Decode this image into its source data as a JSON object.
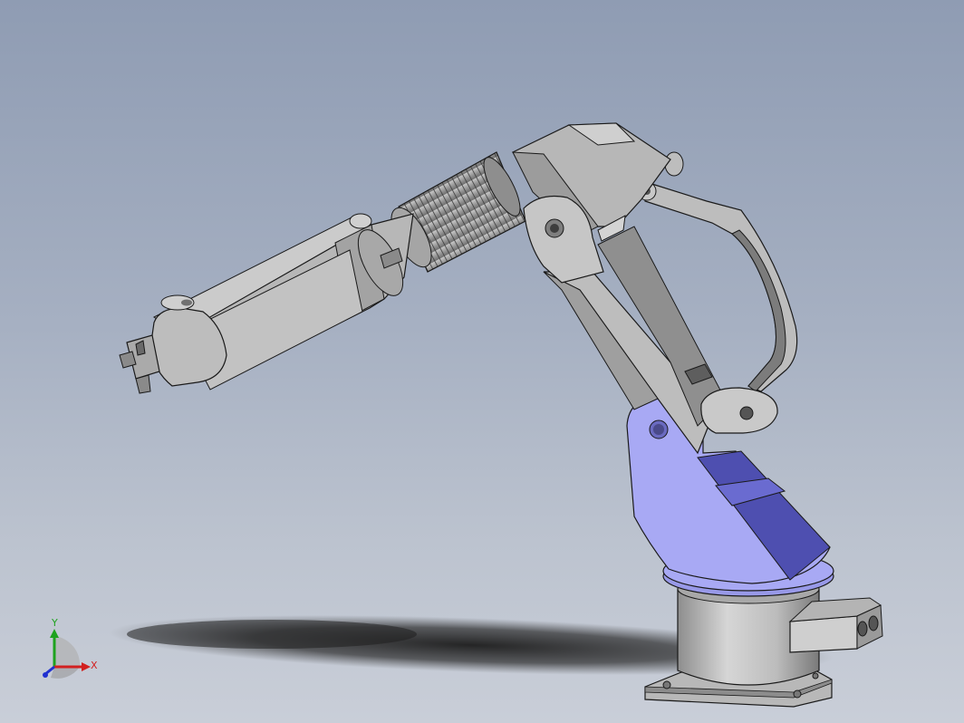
{
  "viewport": {
    "background_top": "#8f9cb3",
    "background_bottom": "#c9ced8",
    "model_color": "#c4c4c4",
    "highlight_color": "#a8a9f4",
    "edge_color": "#1a1a1a"
  },
  "triad": {
    "x_label": "X",
    "y_label": "Y",
    "x_color": "#d22020",
    "y_color": "#1ea21e",
    "z_color": "#2030d0"
  },
  "model": {
    "parts": [
      "base-plate",
      "base-cylinder",
      "side-block",
      "turntable-flange",
      "shoulder-bracket",
      "upper-arm",
      "linkage-loop",
      "elbow-housing",
      "bellows",
      "forearm",
      "wrist",
      "gripper"
    ]
  }
}
